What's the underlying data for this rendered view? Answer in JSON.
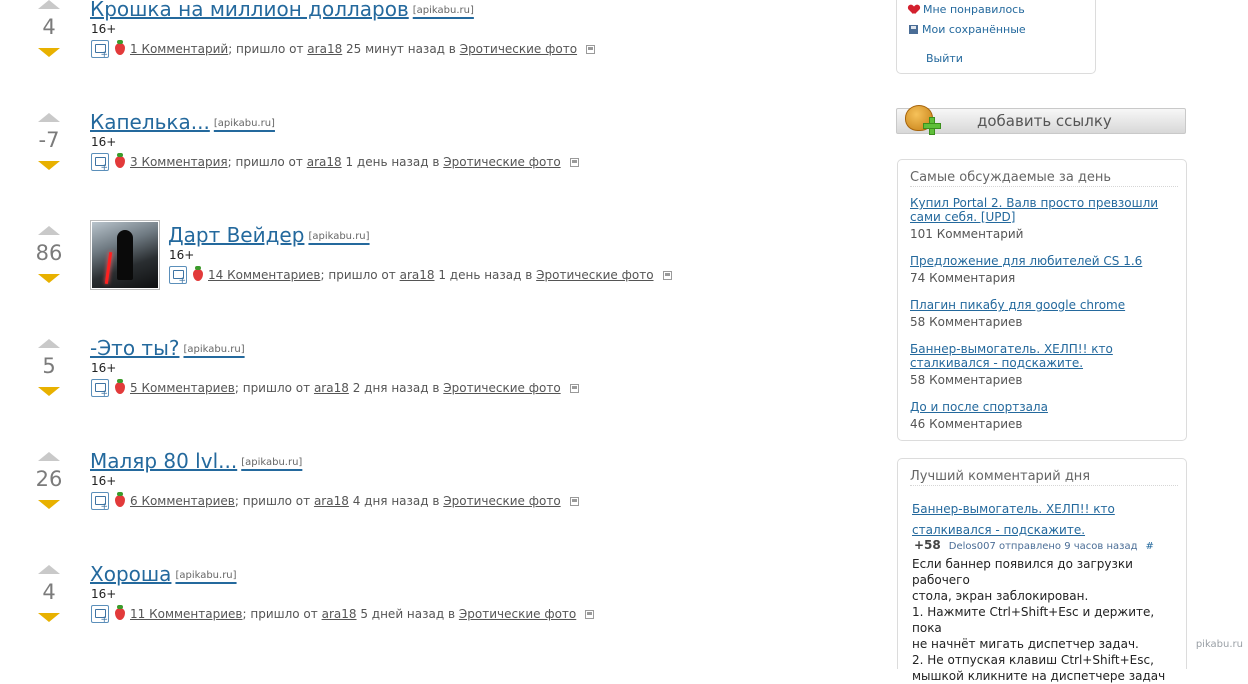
{
  "posts": [
    {
      "rating": "4",
      "title": "Крошка на миллион долларов",
      "domain": "[apikabu.ru]",
      "age": "16+",
      "comments": "1 Комментарий",
      "came_from": "; пришло от",
      "author": "ara18",
      "time": "25 минут назад в",
      "category": "Эротические фото"
    },
    {
      "rating": "-7",
      "title": "Капелька...",
      "domain": "[apikabu.ru]",
      "age": "16+",
      "comments": "3 Комментария",
      "came_from": "; пришло от",
      "author": "ara18",
      "time": "1 день назад в",
      "category": "Эротические фото"
    },
    {
      "rating": "86",
      "title": "Дарт Вейдер",
      "domain": "[apikabu.ru]",
      "age": "16+",
      "comments": "14 Комментариев",
      "came_from": "; пришло от",
      "author": "ara18",
      "time": "1 день назад в",
      "category": "Эротические фото"
    },
    {
      "rating": "5",
      "title": "-Это ты?",
      "domain": "[apikabu.ru]",
      "age": "16+",
      "comments": "5 Комментариев",
      "came_from": "; пришло от",
      "author": "ara18",
      "time": "2 дня назад в",
      "category": "Эротические фото"
    },
    {
      "rating": "26",
      "title": "Маляр 80 lvl...",
      "domain": "[apikabu.ru]",
      "age": "16+",
      "comments": "6 Комментариев",
      "came_from": "; пришло от",
      "author": "ara18",
      "time": "4 дня назад в",
      "category": "Эротические фото"
    },
    {
      "rating": "4",
      "title": "Хороша",
      "domain": "[apikabu.ru]",
      "age": "16+",
      "comments": "11 Комментариев",
      "came_from": "; пришло от",
      "author": "ara18",
      "time": "5 дней назад в",
      "category": "Эротические фото"
    }
  ],
  "userbox": {
    "liked": "Мне понравилось",
    "saved": "Мои сохранённые",
    "logout": "Выйти"
  },
  "add_link": "добавить ссылку",
  "discussed": {
    "title": "Самые обсуждаемые за день",
    "items": [
      {
        "title": "Купил Portal 2. Валв просто превзошли сами себя. [UPD]",
        "count": "101 Комментарий"
      },
      {
        "title": "Предложение для любителей CS 1.6",
        "count": "74 Комментария"
      },
      {
        "title": "Плагин пикабу для google chrome",
        "count": "58 Комментариев"
      },
      {
        "title": "Баннер-вымогатель. ХЕЛП!! кто сталкивался - подскажите.",
        "count": "58 Комментариев"
      },
      {
        "title": "До и после спортзала",
        "count": "46 Комментариев"
      }
    ]
  },
  "best_comment": {
    "title": "Лучший комментарий дня",
    "post_title": "Баннер-вымогатель. ХЕЛП!! кто сталкивался - подскажите.",
    "score": "+58",
    "author_line": "Delos007 отправлено 9 часов назад",
    "hash": "#",
    "body": [
      "Если баннер появился до загрузки рабочего",
      "стола, экран заблокирован.",
      "1. Нажмите Ctrl+Shift+Esc и держите, пока",
      "не начнёт мигать диспетчер задач.",
      "2. Не отпуская клавиш Ctrl+Shift+Esc,",
      "мышкой кликните на диспетчере задач"
    ]
  },
  "watermark": "pikabu.ru",
  "colors": {
    "link": "#24699d",
    "up_arrow": "#c9c9c9",
    "down_arrow": "#e8b100"
  }
}
